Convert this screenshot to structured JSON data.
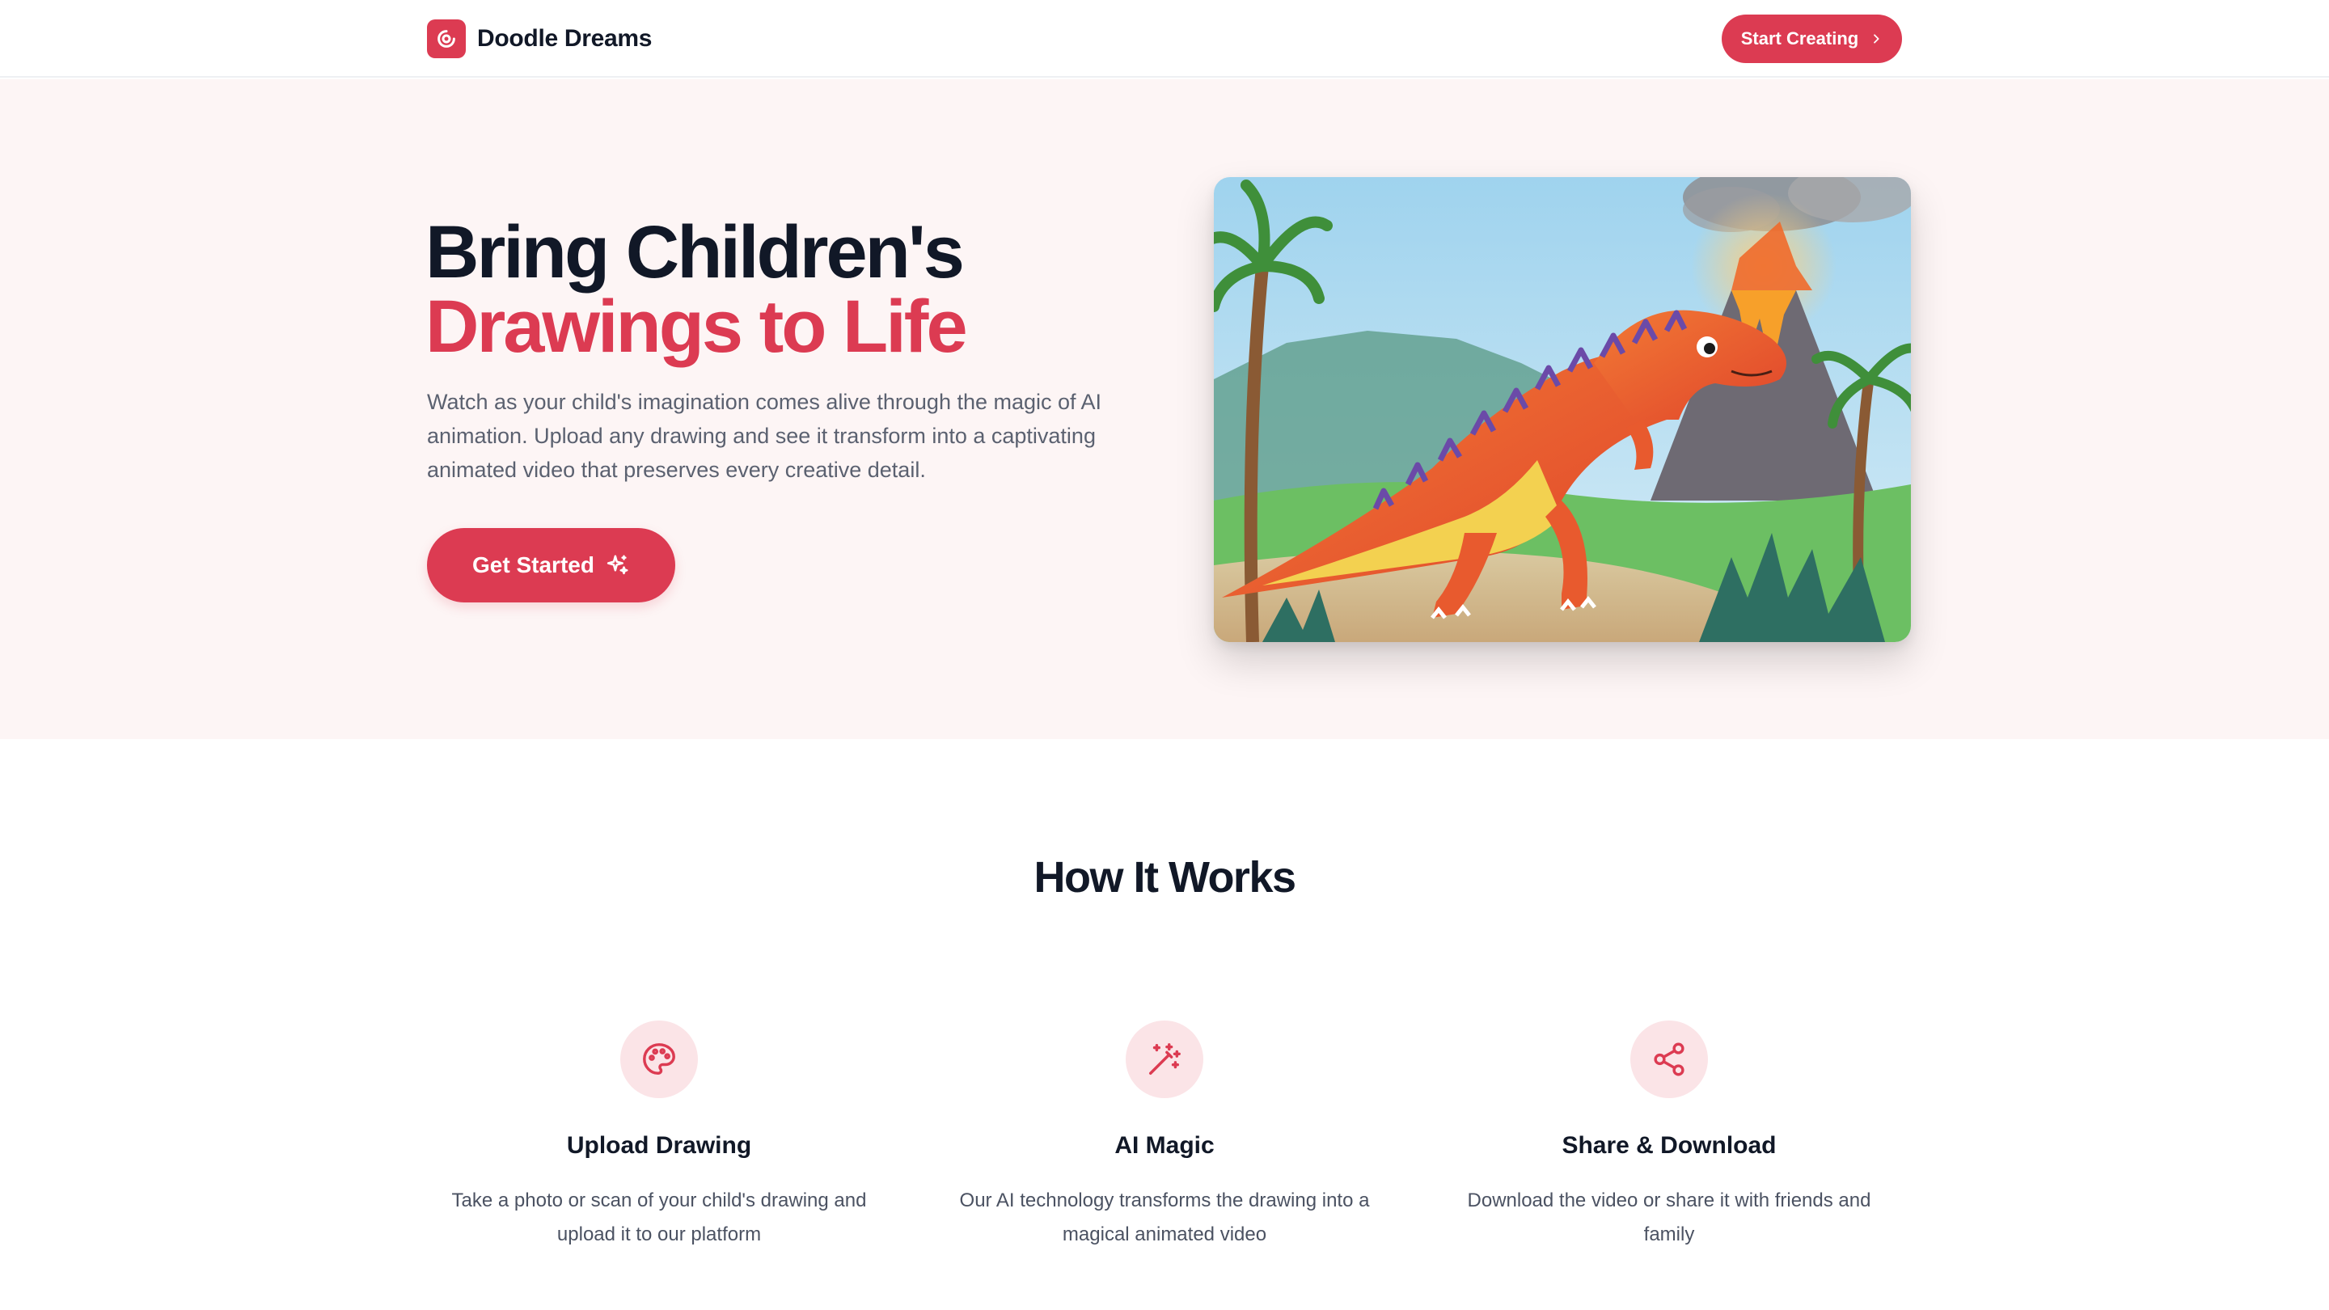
{
  "header": {
    "brand_name": "Doodle Dreams",
    "cta_label": "Start Creating"
  },
  "hero": {
    "title_line1": "Bring Children's",
    "title_line2": "Drawings to Life",
    "description": "Watch as your child's imagination comes alive through the magic of AI animation. Upload any drawing and see it transform into a captivating animated video that preserves every creative detail.",
    "cta_label": "Get Started"
  },
  "how_it_works": {
    "title": "How It Works",
    "steps": [
      {
        "icon": "palette-icon",
        "title": "Upload Drawing",
        "description": "Take a photo or scan of your child's drawing and upload it to our platform"
      },
      {
        "icon": "magic-wand-icon",
        "title": "AI Magic",
        "description": "Our AI technology transforms the drawing into a magical animated video"
      },
      {
        "icon": "share-icon",
        "title": "Share & Download",
        "description": "Download the video or share it with friends and family"
      }
    ]
  },
  "colors": {
    "accent": "#dc3b52",
    "hero_bg": "#fdf5f5",
    "icon_bg": "#fbe4e7",
    "text_dark": "#111827",
    "text_muted": "#5b6170"
  }
}
